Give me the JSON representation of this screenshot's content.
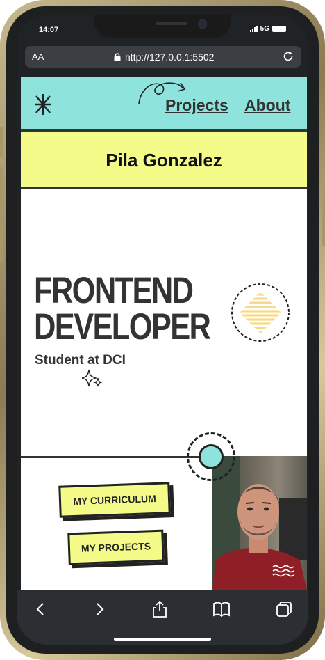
{
  "status": {
    "time": "14:07",
    "network": "5G"
  },
  "browser": {
    "text_size_label": "AA",
    "url": "http://127.0.0.1:5502"
  },
  "nav": {
    "projects_label": "Projects",
    "about_label": "About"
  },
  "profile": {
    "name": "Pila Gonzalez"
  },
  "hero": {
    "title_line1": "FRONTEND",
    "title_line2": "DEVELOPER",
    "subtitle": "Student at DCI"
  },
  "buttons": {
    "curriculum_label": "MY CURRICULUM",
    "projects_label": "MY PROJECTS"
  },
  "colors": {
    "nav_bg": "#8ee3dc",
    "accent_yellow": "#f4fb88",
    "text_dark": "#333333",
    "toolbar_bg": "#2b2f33"
  },
  "icons": [
    "asterisk-logo-icon",
    "curly-arrow-icon",
    "lock-icon",
    "reload-icon",
    "sparkle-icon",
    "striped-diamond-icon",
    "waves-icon",
    "back-icon",
    "forward-icon",
    "share-icon",
    "bookmarks-icon",
    "tabs-icon"
  ]
}
